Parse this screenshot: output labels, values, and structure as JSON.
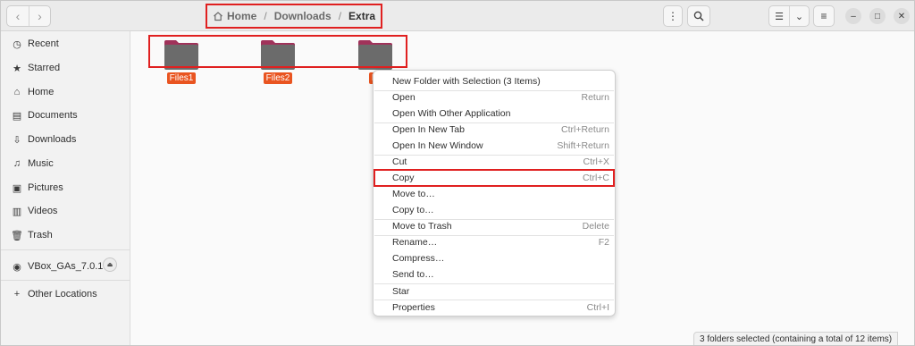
{
  "pathbar": {
    "crumbs": [
      "Home",
      "Downloads",
      "Extra"
    ],
    "separator": "/"
  },
  "sidebar": {
    "items": [
      {
        "label": "Recent",
        "icon": "clock-icon"
      },
      {
        "label": "Starred",
        "icon": "star-icon"
      },
      {
        "label": "Home",
        "icon": "home-icon"
      },
      {
        "label": "Documents",
        "icon": "document-icon"
      },
      {
        "label": "Downloads",
        "icon": "download-icon"
      },
      {
        "label": "Music",
        "icon": "music-icon"
      },
      {
        "label": "Pictures",
        "icon": "picture-icon"
      },
      {
        "label": "Videos",
        "icon": "video-icon"
      },
      {
        "label": "Trash",
        "icon": "trash-icon"
      }
    ],
    "device": {
      "label": "VBox_GAs_7.0.10",
      "icon": "disc-icon"
    },
    "other": {
      "label": "Other Locations",
      "icon": "plus-icon"
    }
  },
  "folders": [
    {
      "label": "Files1",
      "icon": "folder-icon"
    },
    {
      "label": "Files2",
      "icon": "folder-icon"
    },
    {
      "label": "Fi",
      "icon": "folder-icon"
    }
  ],
  "context_menu": {
    "items": [
      {
        "label": "New Folder with Selection (3 Items)",
        "accel": ""
      },
      {
        "label": "Open",
        "accel": "Return"
      },
      {
        "label": "Open With Other Application",
        "accel": ""
      },
      {
        "label": "Open In New Tab",
        "accel": "Ctrl+Return"
      },
      {
        "label": "Open In New Window",
        "accel": "Shift+Return"
      },
      {
        "label": "Cut",
        "accel": "Ctrl+X"
      },
      {
        "label": "Copy",
        "accel": "Ctrl+C"
      },
      {
        "label": "Move to…",
        "accel": ""
      },
      {
        "label": "Copy to…",
        "accel": ""
      },
      {
        "label": "Move to Trash",
        "accel": "Delete"
      },
      {
        "label": "Rename…",
        "accel": "F2"
      },
      {
        "label": "Compress…",
        "accel": ""
      },
      {
        "label": "Send to…",
        "accel": ""
      },
      {
        "label": "Star",
        "accel": ""
      },
      {
        "label": "Properties",
        "accel": "Ctrl+I"
      }
    ]
  },
  "status": {
    "text": "3 folders selected  (containing a total of 12 items)"
  },
  "colors": {
    "selection": "#e95420",
    "annotation": "#e02020",
    "folder_body": "#6b6b6b",
    "folder_tab": "#a0325a"
  }
}
